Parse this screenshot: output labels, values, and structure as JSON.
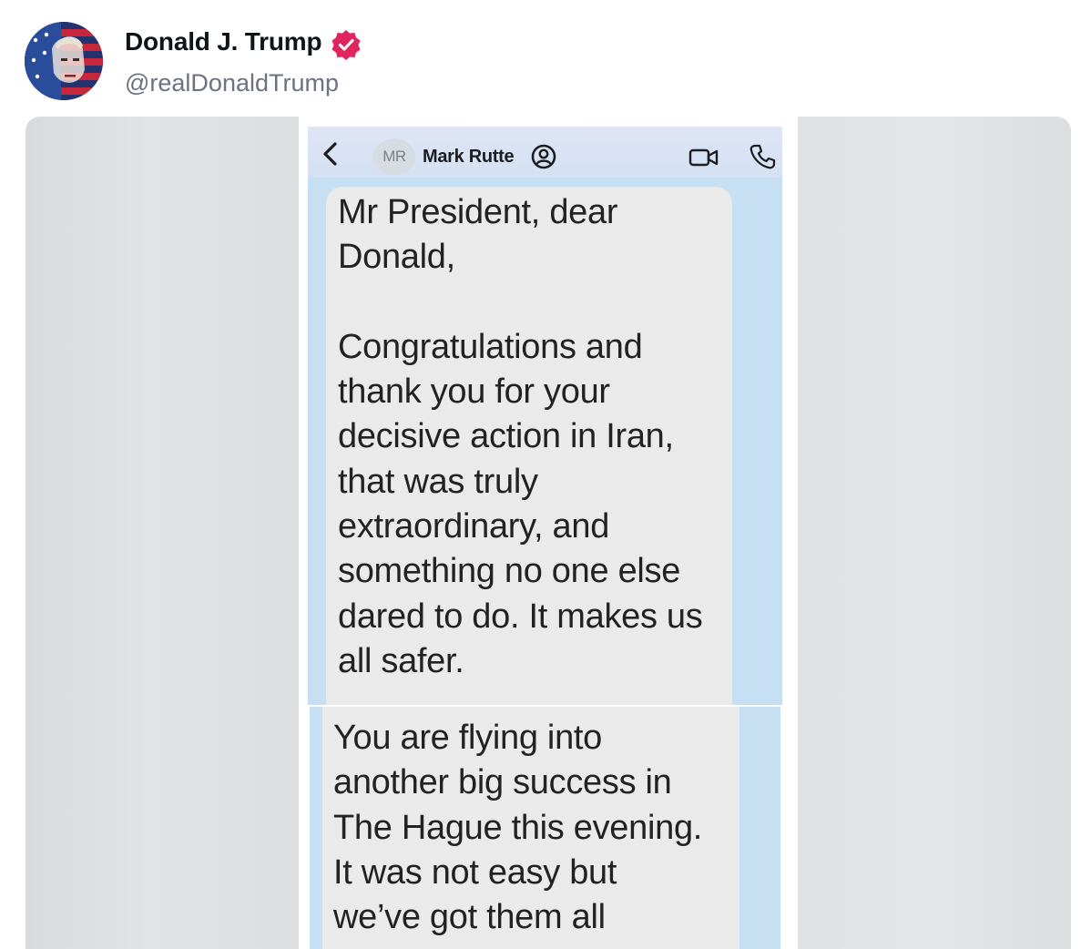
{
  "post": {
    "display_name": "Donald J. Trump",
    "handle": "@realDonaldTrump",
    "verified_icon": "verified-badge-icon",
    "avatar_icon": "profile-avatar",
    "verified_color": "#e0245e"
  },
  "screenshot": {
    "contact_initials": "MR",
    "contact_name": "Mark Rutte",
    "icons": [
      "back-icon",
      "contact-icon",
      "video-call-icon",
      "phone-call-icon"
    ],
    "message_1": "Mr President, dear\nDonald,\n\nCongratulations and\nthank you for your\ndecisive action in Iran,\nthat was truly\nextraordinary, and\nsomething no one else\ndared to do.  It makes us\nall safer.",
    "message_2": "You are flying into\nanother big success in\nThe Hague this evening.\nIt was not easy but\nwe’ve got them all"
  }
}
